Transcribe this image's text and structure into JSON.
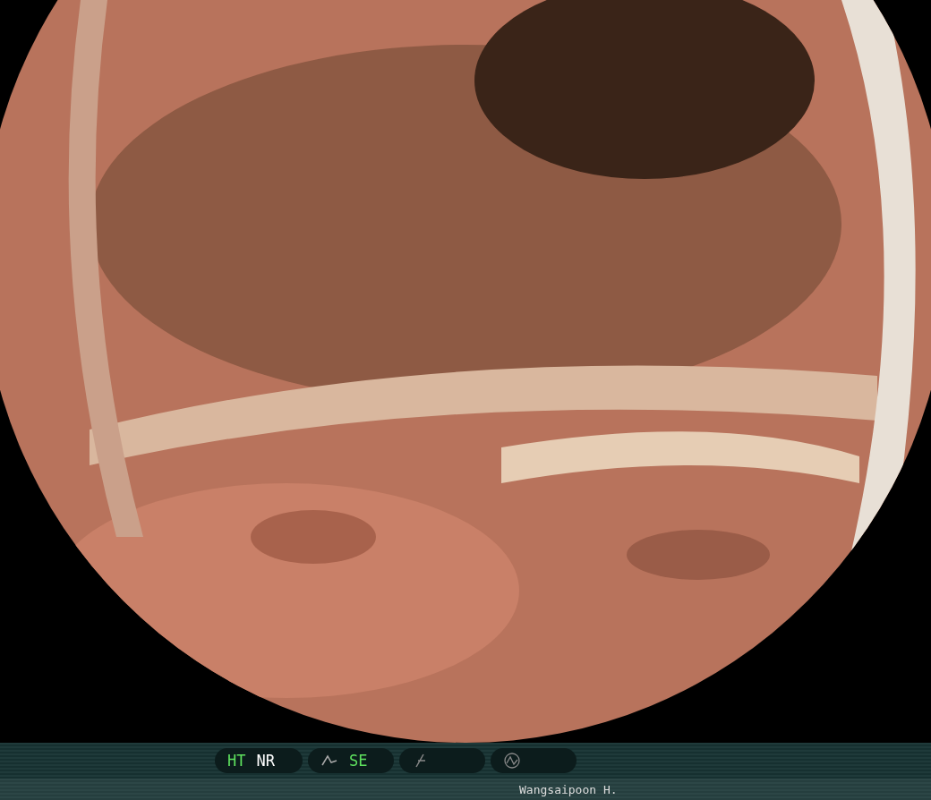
{
  "status_bar": {
    "groups": [
      {
        "kind": "text",
        "items": [
          {
            "label": "HT",
            "active": true
          },
          {
            "label": "NR",
            "active": false
          }
        ]
      },
      {
        "kind": "curve",
        "items": [
          {
            "label": "SE",
            "active": true
          }
        ]
      },
      {
        "kind": "slash"
      },
      {
        "kind": "wave"
      }
    ]
  },
  "operator": "Wangsaipoon H."
}
